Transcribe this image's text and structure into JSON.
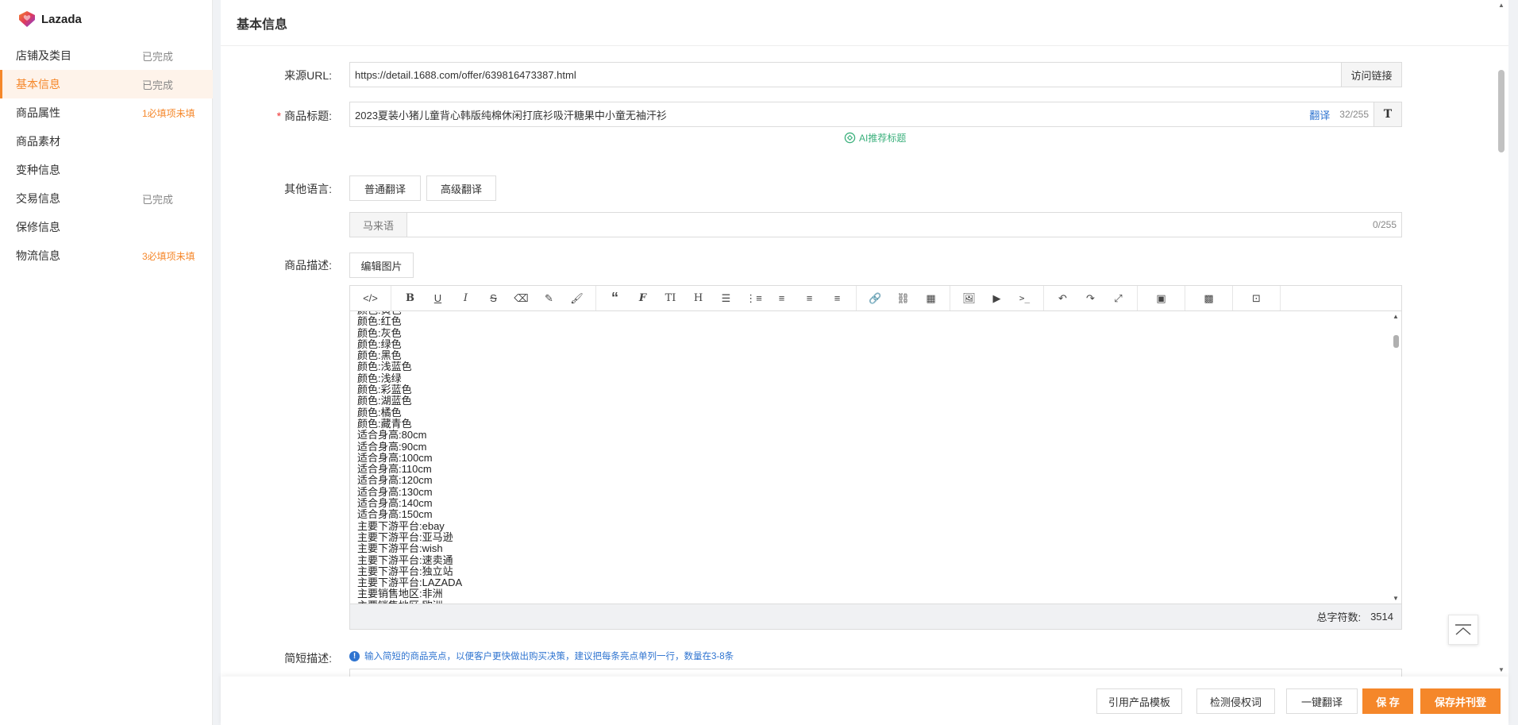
{
  "brand": {
    "name": "Lazada",
    "colors": [
      "#f5872a",
      "#e03a5b",
      "#7b3fe4"
    ]
  },
  "accent_color": "#f5872a",
  "sidebar": {
    "items": [
      {
        "label": "店铺及类目",
        "status": "已完成"
      },
      {
        "label": "基本信息",
        "status": "已完成"
      },
      {
        "label": "商品属性",
        "status": "1必填项未填"
      },
      {
        "label": "商品素材",
        "status": ""
      },
      {
        "label": "变种信息",
        "status": ""
      },
      {
        "label": "交易信息",
        "status": "已完成"
      },
      {
        "label": "保修信息",
        "status": ""
      },
      {
        "label": "物流信息",
        "status": "3必填项未填"
      }
    ],
    "active_index": 1
  },
  "page": {
    "title": "基本信息"
  },
  "form": {
    "source_url": {
      "label": "来源URL:",
      "value": "https://detail.1688.com/offer/639816473387.html",
      "visit_button": "访问链接"
    },
    "product_title": {
      "label": "商品标题:",
      "required_mark": "*",
      "value": "2023夏装小猪儿童背心韩版纯棉休闲打底衫吸汗糖果中小童无袖汗衫",
      "translate_link": "翻译",
      "counter": "32/255",
      "format_icon": "text-format-icon",
      "ai_suggest": "AI推荐标题"
    },
    "other_lang": {
      "label": "其他语言:",
      "normal_translate": "普通翻译",
      "advanced_translate": "高级翻译",
      "lang_tag": "马来语",
      "counter": "0/255"
    },
    "description": {
      "label": "商品描述:",
      "edit_images_button": "编辑图片",
      "lines": [
        "颜色:黄色",
        "颜色:红色",
        "颜色:灰色",
        "颜色:绿色",
        "颜色:黑色",
        "颜色:浅蓝色",
        "颜色:浅绿",
        "颜色:彩蓝色",
        "颜色:湖蓝色",
        "颜色:橘色",
        "颜色:藏青色",
        "适合身高:80cm",
        "适合身高:90cm",
        "适合身高:100cm",
        "适合身高:110cm",
        "适合身高:120cm",
        "适合身高:130cm",
        "适合身高:140cm",
        "适合身高:150cm",
        "主要下游平台:ebay",
        "主要下游平台:亚马逊",
        "主要下游平台:wish",
        "主要下游平台:速卖通",
        "主要下游平台:独立站",
        "主要下游平台:LAZADA",
        "主要销售地区:非洲",
        "主要销售地区:欧洲"
      ],
      "char_count_label": "总字符数:",
      "char_count": "3514"
    },
    "short_description": {
      "label": "简短描述:",
      "hint": "输入简短的商品亮点，以便客户更快做出购买决策，建议把每条亮点单列一行，数量在3-8条"
    }
  },
  "bottom_actions": {
    "use_template": "引用产品模板",
    "check_infringement": "检测侵权词",
    "one_click_translate": "一键翻译",
    "save": "保 存",
    "save_and_publish": "保存并刊登"
  }
}
